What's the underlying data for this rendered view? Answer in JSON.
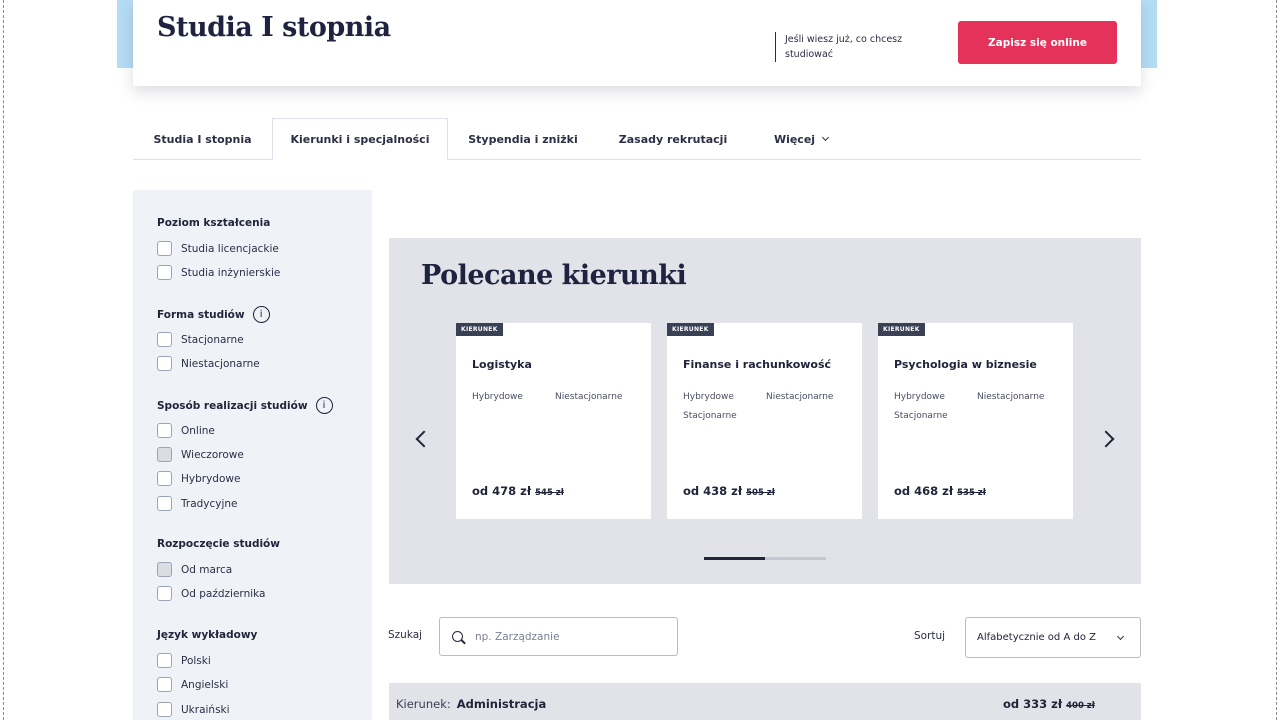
{
  "header": {
    "title": "Studia I stopnia",
    "hint": "Jeśli wiesz już, co chcesz studiować",
    "cta_label": "Zapisz się online"
  },
  "tabs": [
    {
      "label": "Studia I stopnia",
      "active": false
    },
    {
      "label": "Kierunki i specjalności",
      "active": true
    },
    {
      "label": "Stypendia i zniżki",
      "active": false
    },
    {
      "label": "Zasady rekrutacji",
      "active": false
    },
    {
      "label": "Więcej",
      "active": false
    }
  ],
  "filters": {
    "level": {
      "title": "Poziom kształcenia",
      "options": [
        "Studia licencjackie",
        "Studia inżynierskie"
      ]
    },
    "form": {
      "title": "Forma studiów",
      "info_icon": "i",
      "options": [
        "Stacjonarne",
        "Niestacjonarne"
      ]
    },
    "mode": {
      "title": "Sposób realizacji studiów",
      "info_icon": "i",
      "options": [
        "Online",
        "Wieczorowe",
        "Hybrydowe",
        "Tradycyjne"
      ]
    },
    "start": {
      "title": "Rozpoczęcie studiów",
      "options": [
        "Od marca",
        "Od października"
      ]
    },
    "language": {
      "title": "Język wykładowy",
      "options": [
        "Polski",
        "Angielski",
        "Ukraiński"
      ]
    }
  },
  "featured": {
    "title": "Polecane kierunki",
    "progress": 0.5,
    "cards": [
      {
        "badge": "KIERUNEK",
        "name": "Logistyka",
        "tags": [
          "Hybrydowe",
          "Niestacjonarne"
        ],
        "price": "od 478 zł",
        "old_price": "545 zł"
      },
      {
        "badge": "KIERUNEK",
        "name": "Finanse i rachunkowość",
        "tags": [
          "Hybrydowe",
          "Niestacjonarne",
          "Stacjonarne"
        ],
        "price": "od 438 zł",
        "old_price": "505 zł"
      },
      {
        "badge": "KIERUNEK",
        "name": "Psychologia w biznesie",
        "tags": [
          "Hybrydowe",
          "Niestacjonarne",
          "Stacjonarne"
        ],
        "price": "od 468 zł",
        "old_price": "535 zł"
      }
    ]
  },
  "search": {
    "label": "Szukaj",
    "placeholder": "np. Zarządzanie"
  },
  "sort": {
    "label": "Sortuj",
    "value": "Alfabetycznie od A do Z"
  },
  "list": [
    {
      "label": "Kierunek:",
      "name": "Administracja",
      "price": "od 333 zł",
      "old_price": "400 zł"
    }
  ],
  "colors": {
    "accent": "#e5325a",
    "header_band": "#b5dcf5",
    "sidebar": "#eff3f7",
    "panel": "#e1e3e9"
  }
}
